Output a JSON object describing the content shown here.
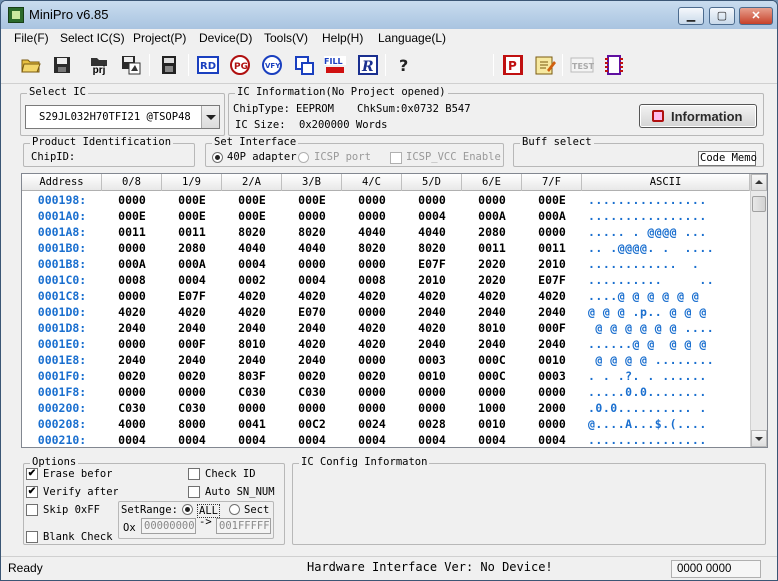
{
  "window": {
    "title": "MiniPro v6.85",
    "controls": {
      "minimize": "▁",
      "maximize": "▢",
      "close": "✕"
    }
  },
  "menu": [
    "File(F)",
    "Select IC(S)",
    "Project(P)",
    "Device(D)",
    "Tools(V)",
    "Help(H)",
    "Language(L)"
  ],
  "toolbar": {
    "prj_label": "prj",
    "verify_label": "VFY",
    "test_label": "TEST"
  },
  "select_ic": {
    "title": "Select IC",
    "value": "S29JL032H70TFI21 @TSOP48"
  },
  "ic_info": {
    "title": "IC Information(No Project opened)",
    "chip_type_label": "ChipType:",
    "chip_type": "EEPROM",
    "chksum_label": "ChkSum:",
    "chksum": "0x0732 B547",
    "ic_size_label": "IC Size:",
    "ic_size": "0x200000 Words"
  },
  "information_button": "Information",
  "product_id": {
    "title": "Product Identification",
    "chip_id_label": "ChipID:"
  },
  "set_interface": {
    "title": "Set Interface",
    "option_40p": "40P adapter",
    "option_icsp": "ICSP port",
    "option_vcc": "ICSP_VCC Enable"
  },
  "buff_select": {
    "title": "Buff select",
    "code_memo": "Code Memo"
  },
  "grid": {
    "headers": [
      "Address",
      "0/8",
      "1/9",
      "2/A",
      "3/B",
      "4/C",
      "5/D",
      "6/E",
      "7/F",
      "ASCII"
    ],
    "rows": [
      {
        "addr": "000198:",
        "vals": [
          "0000",
          "000E",
          "000E",
          "000E",
          "0000",
          "0000",
          "0000",
          "000E"
        ],
        "ascii": "................"
      },
      {
        "addr": "0001A0:",
        "vals": [
          "000E",
          "000E",
          "000E",
          "0000",
          "0000",
          "0004",
          "000A",
          "000A"
        ],
        "ascii": "................"
      },
      {
        "addr": "0001A8:",
        "vals": [
          "0011",
          "0011",
          "8020",
          "8020",
          "4040",
          "4040",
          "2080",
          "0000"
        ],
        "ascii": "..... . @@@@ ..."
      },
      {
        "addr": "0001B0:",
        "vals": [
          "0000",
          "2080",
          "4040",
          "4040",
          "8020",
          "8020",
          "0011",
          "0011"
        ],
        "ascii": ".. .@@@@. .  ...."
      },
      {
        "addr": "0001B8:",
        "vals": [
          "000A",
          "000A",
          "0004",
          "0000",
          "0000",
          "E07F",
          "2020",
          "2010"
        ],
        "ascii": "............  . "
      },
      {
        "addr": "0001C0:",
        "vals": [
          "0008",
          "0004",
          "0002",
          "0004",
          "0008",
          "2010",
          "2020",
          "E07F"
        ],
        "ascii": "..........     .."
      },
      {
        "addr": "0001C8:",
        "vals": [
          "0000",
          "E07F",
          "4020",
          "4020",
          "4020",
          "4020",
          "4020",
          "4020"
        ],
        "ascii": "....@ @ @ @ @ @ "
      },
      {
        "addr": "0001D0:",
        "vals": [
          "4020",
          "4020",
          "4020",
          "E070",
          "0000",
          "2040",
          "2040",
          "2040"
        ],
        "ascii": "@ @ @ .p.. @ @ @ "
      },
      {
        "addr": "0001D8:",
        "vals": [
          "2040",
          "2040",
          "2040",
          "2040",
          "4020",
          "4020",
          "8010",
          "000F"
        ],
        "ascii": " @ @ @ @ @ @ ...."
      },
      {
        "addr": "0001E0:",
        "vals": [
          "0000",
          "000F",
          "8010",
          "4020",
          "4020",
          "2040",
          "2040",
          "2040"
        ],
        "ascii": "......@ @  @ @ @ "
      },
      {
        "addr": "0001E8:",
        "vals": [
          "2040",
          "2040",
          "2040",
          "2040",
          "0000",
          "0003",
          "000C",
          "0010"
        ],
        "ascii": " @ @ @ @ ........"
      },
      {
        "addr": "0001F0:",
        "vals": [
          "0020",
          "0020",
          "803F",
          "0020",
          "0020",
          "0010",
          "000C",
          "0003"
        ],
        "ascii": ". . .?. . ......"
      },
      {
        "addr": "0001F8:",
        "vals": [
          "0000",
          "0000",
          "C030",
          "C030",
          "0000",
          "0000",
          "0000",
          "0000"
        ],
        "ascii": ".....0.0........"
      },
      {
        "addr": "000200:",
        "vals": [
          "C030",
          "C030",
          "0000",
          "0000",
          "0000",
          "0000",
          "1000",
          "2000"
        ],
        "ascii": ".0.0.......... ."
      },
      {
        "addr": "000208:",
        "vals": [
          "4000",
          "8000",
          "0041",
          "00C2",
          "0024",
          "0028",
          "0010",
          "0000"
        ],
        "ascii": "@....A...$.(...."
      },
      {
        "addr": "000210:",
        "vals": [
          "0004",
          "0004",
          "0004",
          "0004",
          "0004",
          "0004",
          "0004",
          "0004"
        ],
        "ascii": "................"
      }
    ]
  },
  "options": {
    "title": "Options",
    "erase_before": "Erase before",
    "verify_after": "Verify after",
    "skip_0xff": "Skip 0xFF",
    "blank_check": "Blank Check",
    "check_id": "Check ID",
    "auto_sn_num": "Auto SN_NUM",
    "set_range_label": "SetRange:",
    "range_all": "ALL",
    "range_sect": "Sect",
    "ox_label": "Ox",
    "range_from": "00000000",
    "range_arrow": "->",
    "range_to": "001FFFFF"
  },
  "ic_config": {
    "title": "IC Config Informaton"
  },
  "status": {
    "ready": "Ready",
    "hardware": "Hardware Interface Ver: No Device!",
    "code": "0000 0000"
  },
  "colors": {
    "address_blue": "#1a6fcf",
    "ascii_blue": "#1a6fcf"
  }
}
